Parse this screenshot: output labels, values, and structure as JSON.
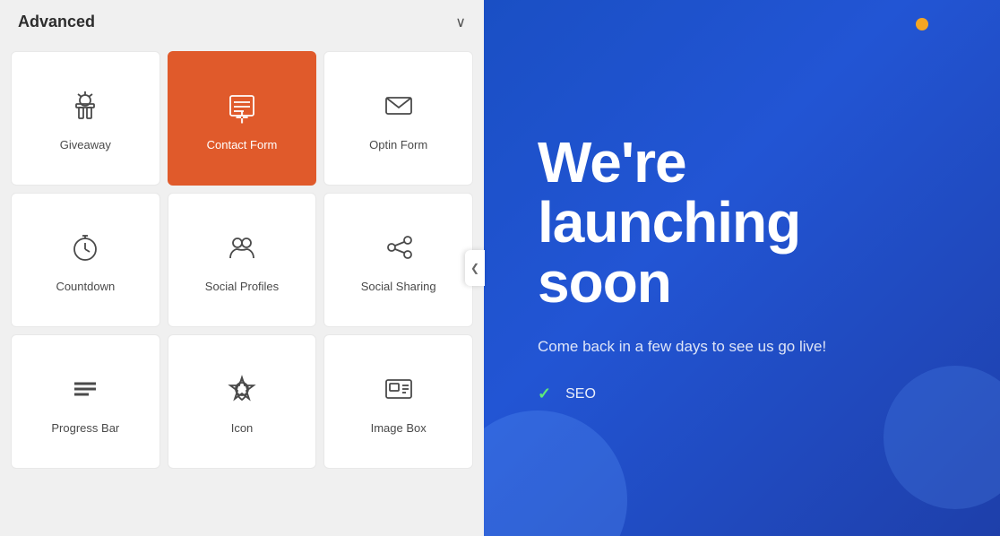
{
  "panel": {
    "title": "Advanced",
    "chevron": "∨"
  },
  "widgets": [
    {
      "id": "giveaway",
      "label": "Giveaway",
      "icon": "giveaway",
      "active": false
    },
    {
      "id": "contact-form",
      "label": "Contact Form",
      "icon": "contact-form",
      "active": true
    },
    {
      "id": "optin-form",
      "label": "Optin Form",
      "icon": "optin-form",
      "active": false
    },
    {
      "id": "countdown",
      "label": "Countdown",
      "icon": "countdown",
      "active": false
    },
    {
      "id": "social-profiles",
      "label": "Social Profiles",
      "icon": "social-profiles",
      "active": false
    },
    {
      "id": "social-sharing",
      "label": "Social Sharing",
      "icon": "social-sharing",
      "active": false
    },
    {
      "id": "progress-bar",
      "label": "Progress Bar",
      "icon": "progress-bar",
      "active": false
    },
    {
      "id": "icon",
      "label": "Icon",
      "icon": "icon-widget",
      "active": false
    },
    {
      "id": "image-box",
      "label": "Image Box",
      "icon": "image-box",
      "active": false
    }
  ],
  "preview": {
    "heading": "We're launching soon",
    "subtext": "Come back in a few days to see us go live!",
    "features": [
      "SEO"
    ]
  },
  "collapse_icon": "❮"
}
